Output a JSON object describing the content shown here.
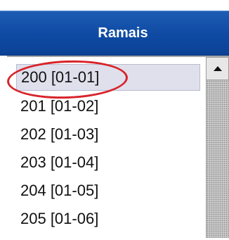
{
  "header": {
    "title": "Ramais"
  },
  "extensions": [
    "200 [01-01]",
    "201 [01-02]",
    "202 [01-03]",
    "203 [01-04]",
    "204 [01-05]",
    "205 [01-06]"
  ],
  "selected_index": 0,
  "scrollbar": {
    "up_icon": "triangle-up-icon"
  },
  "colors": {
    "header_bg": "#0e4aa3",
    "header_text": "#ffffff",
    "selected_bg": "#dfe0ec",
    "annotation_ring": "#d8232a"
  }
}
